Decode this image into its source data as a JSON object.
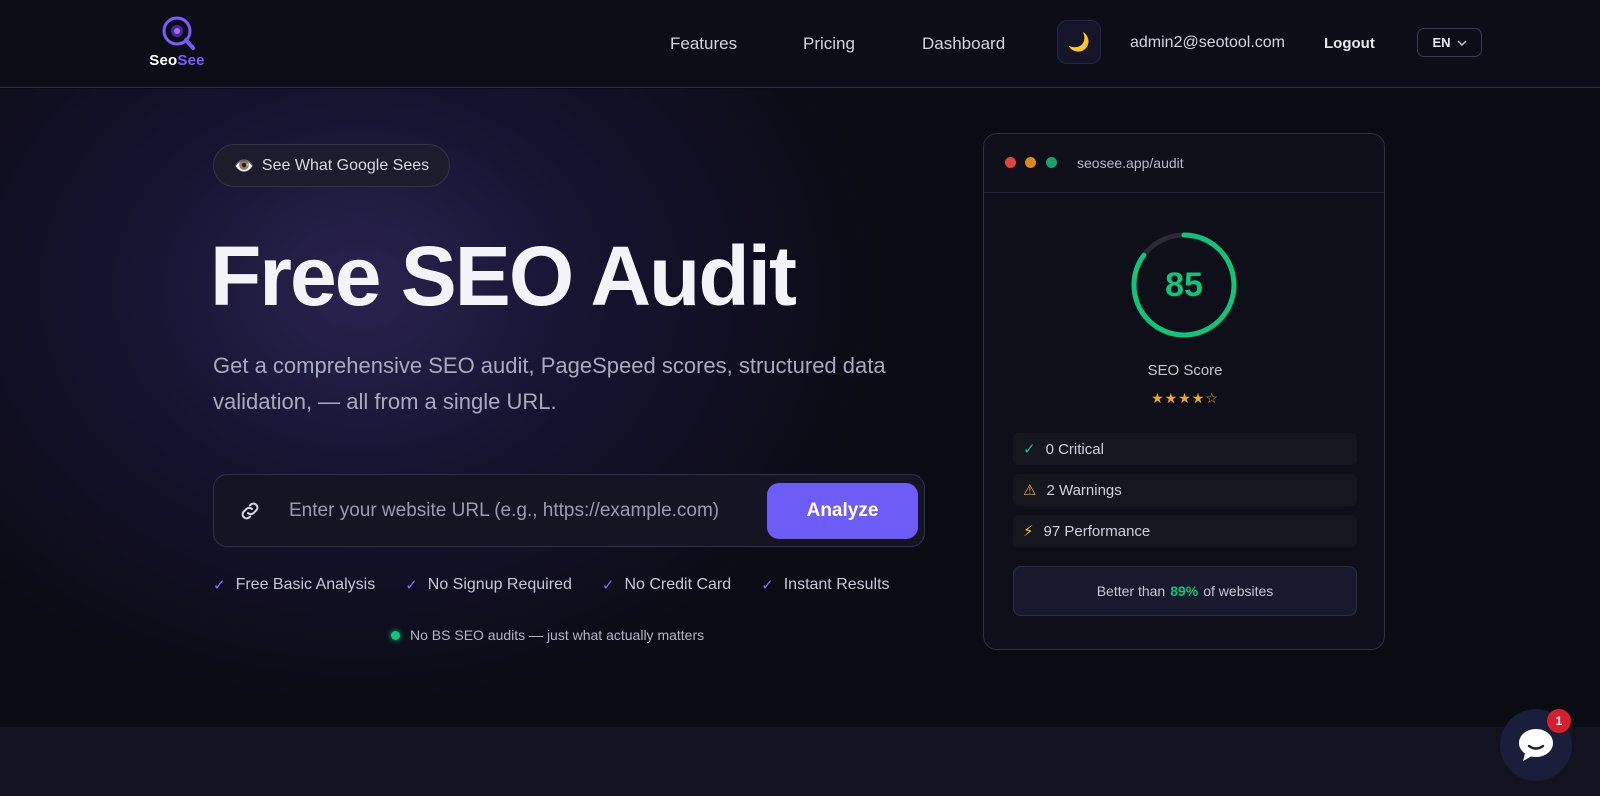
{
  "brand": {
    "name_part1": "Seo",
    "name_part2": "See",
    "accent": "#7c5cff"
  },
  "nav": {
    "links": [
      "Features",
      "Pricing",
      "Dashboard"
    ],
    "theme_icon": "moon-icon",
    "email": "admin2@seotool.com",
    "logout": "Logout",
    "lang": "EN"
  },
  "hero": {
    "badge": "See What Google Sees",
    "title": "Free SEO Audit",
    "subtitle": "Get a comprehensive SEO audit, PageSpeed scores, structured data validation, — all from a single URL.",
    "search": {
      "placeholder": "Enter your website URL (e.g., https://example.com)",
      "value": "",
      "button": "Analyze"
    },
    "features": [
      "Free Basic Analysis",
      "No Signup Required",
      "No Credit Card",
      "Instant Results"
    ],
    "tagline": "No BS SEO audits — just what actually matters"
  },
  "card": {
    "url": "seosee.app/audit",
    "score": "85",
    "score_fraction": 0.85,
    "score_label": "SEO Score",
    "stars": "★★★★☆",
    "stats": [
      {
        "icon": "✓",
        "icon_color": "#10c47a",
        "text": "0 Critical"
      },
      {
        "icon": "⚠",
        "icon_color": "#e9a830",
        "text": "2 Warnings"
      },
      {
        "icon": "⚡",
        "icon_color": "#e9c030",
        "text": "97 Performance"
      }
    ],
    "better_prefix": "Better than",
    "better_value": "89%",
    "better_suffix": "of websites"
  },
  "chat": {
    "unread": "1"
  },
  "colors": {
    "green": "#10c47a",
    "purple": "#6d5cf6",
    "bg": "#0b0b14"
  }
}
